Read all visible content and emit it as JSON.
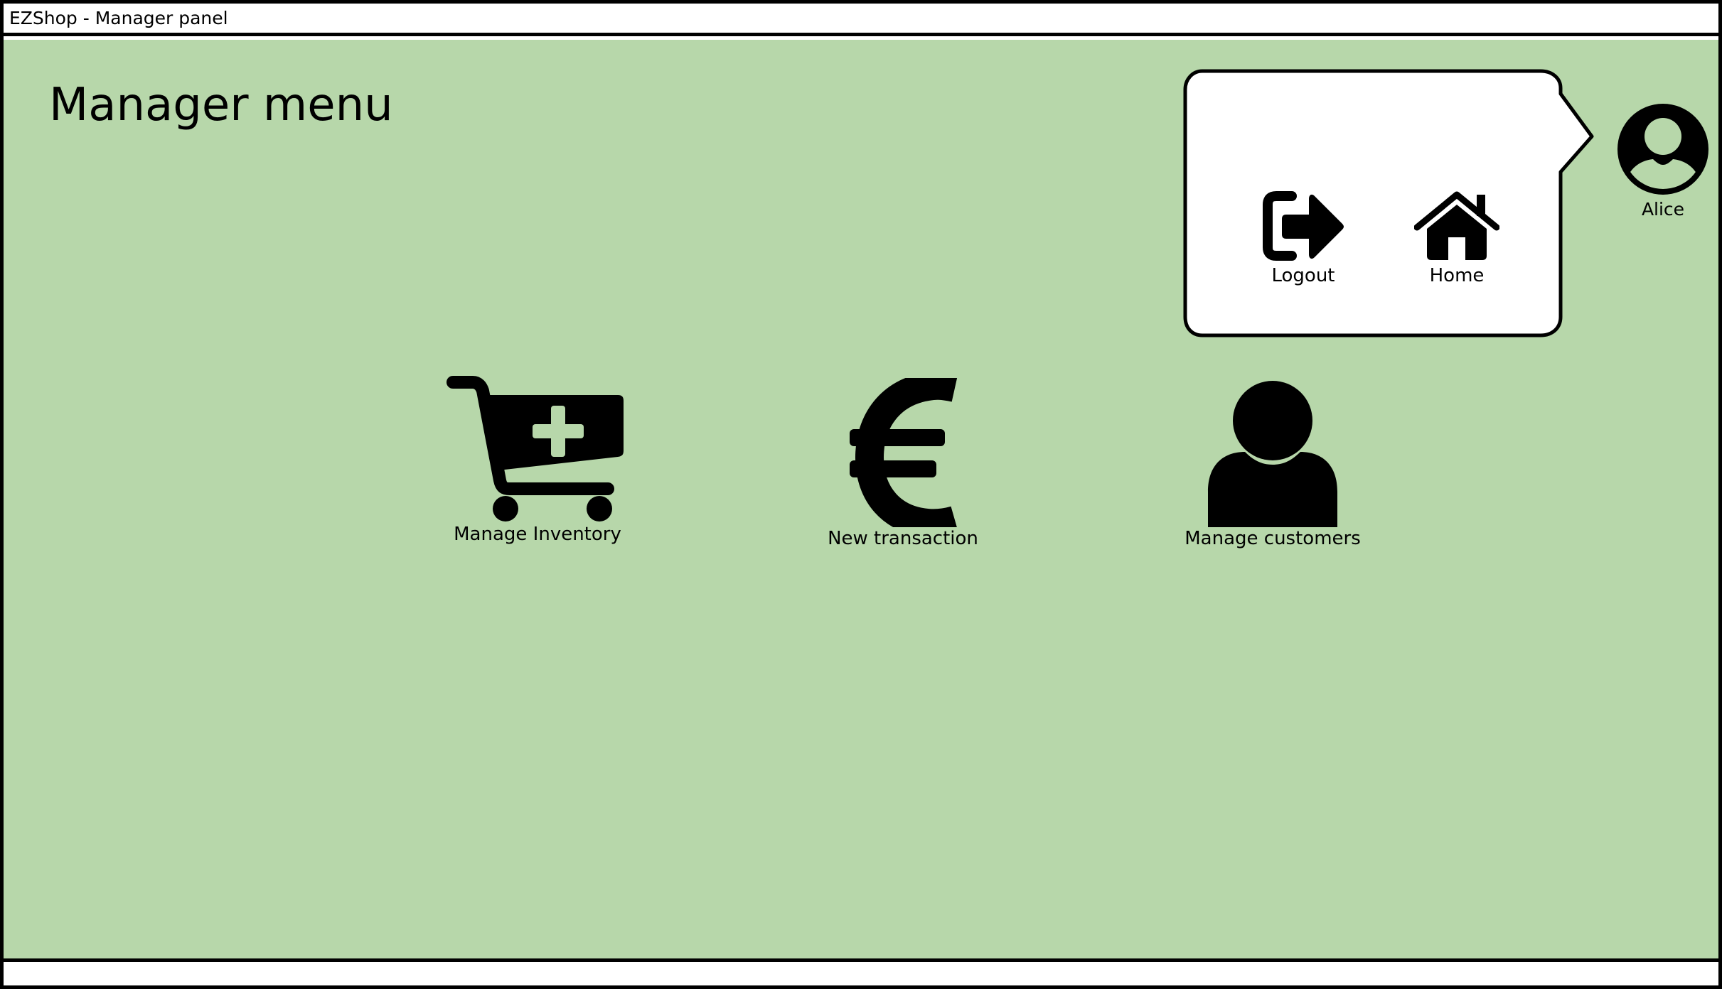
{
  "window": {
    "title": "EZShop - Manager panel"
  },
  "page": {
    "title": "Manager menu"
  },
  "menu": {
    "items": [
      {
        "label": "Manage Inventory",
        "icon": "cart-plus-icon"
      },
      {
        "label": "New transaction",
        "icon": "euro-icon"
      },
      {
        "label": "Manage customers",
        "icon": "user-icon"
      }
    ]
  },
  "user_menu": {
    "logout_label": "Logout",
    "home_label": "Home",
    "logout_icon": "logout-icon",
    "home_icon": "home-icon"
  },
  "user": {
    "name": "Alice",
    "icon": "avatar-icon"
  },
  "colors": {
    "background": "#b7d7aa",
    "frame": "#000000",
    "panel": "#ffffff"
  }
}
